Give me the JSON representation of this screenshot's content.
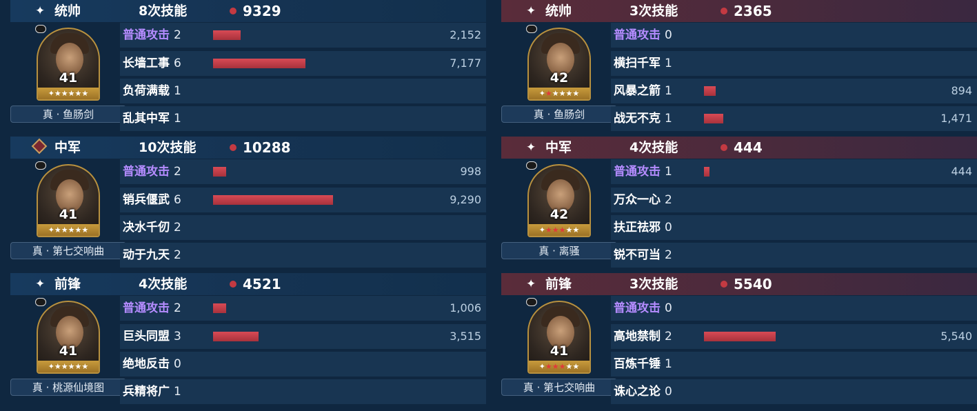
{
  "max_damage_scale": 9290,
  "left_team": [
    {
      "role": "统帅",
      "role_icon": "sparkle-icon",
      "casts": "8次技能",
      "total": "9329",
      "level": "41",
      "stars_total": 6,
      "stars_red": 0,
      "gear": "真 · 鱼肠剑",
      "skills": [
        {
          "name": "普通攻击",
          "count": "2",
          "value": "2,152",
          "damage": 2152,
          "basic": true
        },
        {
          "name": "长墙工事",
          "count": "6",
          "value": "7,177",
          "damage": 7177
        },
        {
          "name": "负荷满载",
          "count": "1",
          "value": "",
          "damage": 0
        },
        {
          "name": "乱其中军",
          "count": "1",
          "value": "",
          "damage": 0
        }
      ]
    },
    {
      "role": "中军",
      "role_icon": "diamond-emblem-icon",
      "casts": "10次技能",
      "total": "10288",
      "level": "41",
      "stars_total": 6,
      "stars_red": 0,
      "gear": "真 · 第七交响曲",
      "skills": [
        {
          "name": "普通攻击",
          "count": "2",
          "value": "998",
          "damage": 998,
          "basic": true
        },
        {
          "name": "销兵偃武",
          "count": "6",
          "value": "9,290",
          "damage": 9290
        },
        {
          "name": "决水千仞",
          "count": "2",
          "value": "",
          "damage": 0
        },
        {
          "name": "动于九天",
          "count": "2",
          "value": "",
          "damage": 0
        }
      ]
    },
    {
      "role": "前锋",
      "role_icon": "sparkle-icon",
      "casts": "4次技能",
      "total": "4521",
      "level": "41",
      "stars_total": 6,
      "stars_red": 0,
      "gear": "真 · 桃源仙境图",
      "skills": [
        {
          "name": "普通攻击",
          "count": "2",
          "value": "1,006",
          "damage": 1006,
          "basic": true
        },
        {
          "name": "巨头同盟",
          "count": "3",
          "value": "3,515",
          "damage": 3515
        },
        {
          "name": "绝地反击",
          "count": "0",
          "value": "",
          "damage": 0
        },
        {
          "name": "兵精将广",
          "count": "1",
          "value": "",
          "damage": 0
        }
      ]
    }
  ],
  "right_team": [
    {
      "role": "统帅",
      "role_icon": "sparkle-icon",
      "casts": "3次技能",
      "total": "2365",
      "level": "42",
      "stars_total": 6,
      "stars_red": 1,
      "gear": "真 · 鱼肠剑",
      "skills": [
        {
          "name": "普通攻击",
          "count": "0",
          "value": "",
          "damage": 0,
          "basic": true
        },
        {
          "name": "横扫千军",
          "count": "1",
          "value": "",
          "damage": 0
        },
        {
          "name": "风暴之箭",
          "count": "1",
          "value": "894",
          "damage": 894
        },
        {
          "name": "战无不克",
          "count": "1",
          "value": "1,471",
          "damage": 1471
        }
      ]
    },
    {
      "role": "中军",
      "role_icon": "sparkle-icon",
      "casts": "4次技能",
      "total": "444",
      "level": "42",
      "stars_total": 6,
      "stars_red": 3,
      "gear": "真 · 离骚",
      "skills": [
        {
          "name": "普通攻击",
          "count": "1",
          "value": "444",
          "damage": 444,
          "basic": true
        },
        {
          "name": "万众一心",
          "count": "2",
          "value": "",
          "damage": 0
        },
        {
          "name": "扶正祛邪",
          "count": "0",
          "value": "",
          "damage": 0
        },
        {
          "name": "锐不可当",
          "count": "2",
          "value": "",
          "damage": 0
        }
      ]
    },
    {
      "role": "前锋",
      "role_icon": "sparkle-icon",
      "casts": "3次技能",
      "total": "5540",
      "level": "41",
      "stars_total": 6,
      "stars_red": 3,
      "gear": "真 · 第七交响曲",
      "skills": [
        {
          "name": "普通攻击",
          "count": "0",
          "value": "",
          "damage": 0,
          "basic": true
        },
        {
          "name": "高地禁制",
          "count": "2",
          "value": "5,540",
          "damage": 5540
        },
        {
          "name": "百炼千锤",
          "count": "1",
          "value": "",
          "damage": 0
        },
        {
          "name": "诛心之论",
          "count": "0",
          "value": "",
          "damage": 0
        }
      ]
    }
  ]
}
